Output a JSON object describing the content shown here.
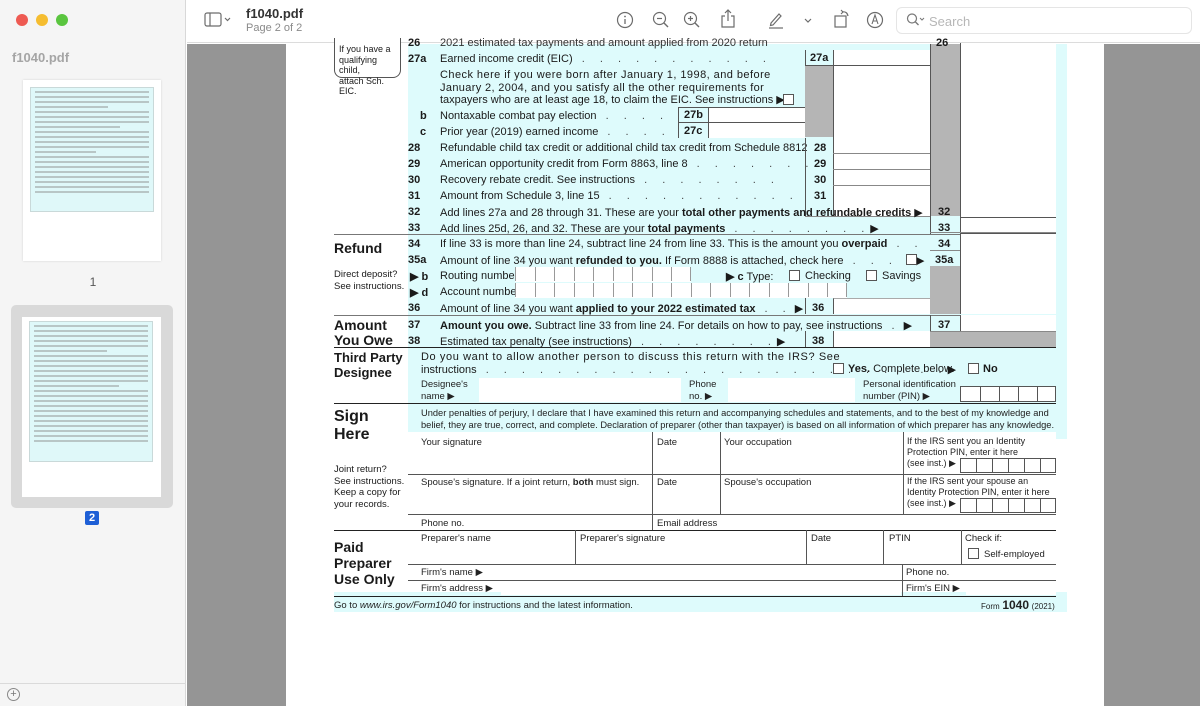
{
  "window": {
    "title": "f1040.pdf",
    "subtitle": "Page 2 of 2"
  },
  "sidebar": {
    "title": "f1040.pdf",
    "pages": [
      {
        "label": "1",
        "selected": false
      },
      {
        "label": "2",
        "selected": true
      }
    ],
    "add_icon": "plus-circle-icon"
  },
  "toolbar": {
    "search_placeholder": "Search",
    "icons": [
      "sidebar-toggle-icon",
      "info-icon",
      "zoom-out-icon",
      "zoom-in-icon",
      "share-icon",
      "markup-pen-icon",
      "chevron-down-icon",
      "rotate-icon",
      "annotate-icon",
      "search-icon"
    ]
  },
  "colors": {
    "form_cyan": "#defbfc",
    "selected_page": "#1e5fd6",
    "canvas_bg": "#959595"
  },
  "form": {
    "eic_note": [
      "If you have a",
      "qualifying child,",
      "attach Sch. EIC."
    ],
    "line26_partial": "2021 estimated tax payments and amount applied from 2020 return",
    "lines": {
      "l26_num": "26",
      "l27a_num": "27a",
      "l27a_text": "Earned income credit (EIC)",
      "l27a_box": "27a",
      "l27a_check": [
        "Check here if you were born after January 1, 1998, and before",
        "January 2, 2004, and you satisfy all the other requirements for",
        "taxpayers who are at least age 18, to claim the EIC. See instructions ▶"
      ],
      "l27b_num": "b",
      "l27b_text": "Nontaxable combat pay election",
      "l27b_box": "27b",
      "l27c_num": "c",
      "l27c_text": "Prior year (2019) earned income",
      "l27c_box": "27c",
      "l28_num": "28",
      "l28_text": "Refundable child tax credit or additional child tax credit from Schedule 8812",
      "l28_box": "28",
      "l29_num": "29",
      "l29_text": "American opportunity credit from Form 8863, line 8",
      "l29_box": "29",
      "l30_num": "30",
      "l30_text": "Recovery rebate credit. See instructions",
      "l30_box": "30",
      "l31_num": "31",
      "l31_text": "Amount from Schedule 3, line 15",
      "l31_box": "31",
      "l32_num": "32",
      "l32_text": "Add lines 27a and 28 through 31. These are your",
      "l32_bold": "total other payments and refundable credits",
      "l32_box": "32",
      "l33_num": "33",
      "l33_text": "Add lines 25d, 26, and 32. These are your",
      "l33_bold": "total payments",
      "l33_box": "33"
    },
    "refund": {
      "title": "Refund",
      "side_note": [
        "Direct deposit?",
        "See instructions."
      ],
      "l34_num": "34",
      "l34_text": "If line 33 is more than line 24, subtract line 24 from line 33. This is the amount you",
      "l34_bold": "overpaid",
      "l34_box": "34",
      "l35a_num": "35a",
      "l35a_text": "Amount of line 34 you want",
      "l35a_bold": "refunded to you.",
      "l35a_text2": "If Form 8888 is attached, check here",
      "l35a_box": "35a",
      "l35b_num": "▶ b",
      "l35b_text": "Routing number",
      "l35c_label": "▶ c",
      "l35c_type": "Type:",
      "checking": "Checking",
      "savings": "Savings",
      "l35d_num": "▶ d",
      "l35d_text": "Account number",
      "l36_num": "36",
      "l36_text": "Amount of line 34 you want",
      "l36_bold": "applied to your 2022 estimated tax",
      "l36_box": "36"
    },
    "owe": {
      "title": [
        "Amount",
        "You Owe"
      ],
      "l37_num": "37",
      "l37_bold": "Amount you owe.",
      "l37_text": "Subtract line 33 from line 24. For details on how to pay, see instructions",
      "l37_box": "37",
      "l38_num": "38",
      "l38_text": "Estimated tax penalty (see instructions)",
      "l38_box": "38"
    },
    "third_party": {
      "title": [
        "Third Party",
        "Designee"
      ],
      "question": "Do you want to allow another person to discuss this return with the IRS? See",
      "question2": "instructions",
      "yes_bold": "Yes.",
      "yes_text": "Complete below.",
      "no": "No",
      "designee_name": [
        "Designee's",
        "name ▶"
      ],
      "phone": [
        "Phone",
        "no. ▶"
      ],
      "pin": [
        "Personal identification",
        "number (PIN) ▶"
      ]
    },
    "sign": {
      "title": [
        "Sign",
        "Here"
      ],
      "perjury": [
        "Under penalties of perjury, I declare that I have examined this return and accompanying schedules and statements, and to the best of my knowledge and",
        "belief, they are true, correct, and complete. Declaration of preparer (other than taxpayer) is based on all information of which preparer has any knowledge."
      ],
      "side_note": [
        "Joint return?",
        "See instructions.",
        "Keep a copy for",
        "your records."
      ],
      "your_signature": "Your signature",
      "date": "Date",
      "your_occupation": "Your occupation",
      "ip_pin": [
        "If the IRS sent you an Identity",
        "Protection PIN, enter it here",
        "(see inst.) ▶"
      ],
      "spouse_signature": "Spouse's signature. If a joint return,",
      "spouse_bold": "both",
      "spouse_sig_end": "must sign.",
      "spouse_occupation": "Spouse's occupation",
      "spouse_ip_pin": [
        "If the IRS sent your spouse an",
        "Identity Protection PIN, enter it here",
        "(see inst.) ▶"
      ],
      "phone": "Phone no.",
      "email": "Email address"
    },
    "preparer": {
      "title": [
        "Paid",
        "Preparer",
        "Use Only"
      ],
      "name": "Preparer's name",
      "signature": "Preparer's signature",
      "date": "Date",
      "ptin": "PTIN",
      "check_if": "Check if:",
      "self_employed": "Self-employed",
      "firm_name": "Firm's name ▶",
      "phone": "Phone no.",
      "firm_address": "Firm's address ▶",
      "firm_ein": "Firm's EIN ▶"
    },
    "footer": {
      "left_pre": "Go to",
      "left_link": "www.irs.gov/Form1040",
      "left_post": "for instructions and the latest information.",
      "form_label": "Form",
      "form_num": "1040",
      "year": "(2021)"
    }
  }
}
